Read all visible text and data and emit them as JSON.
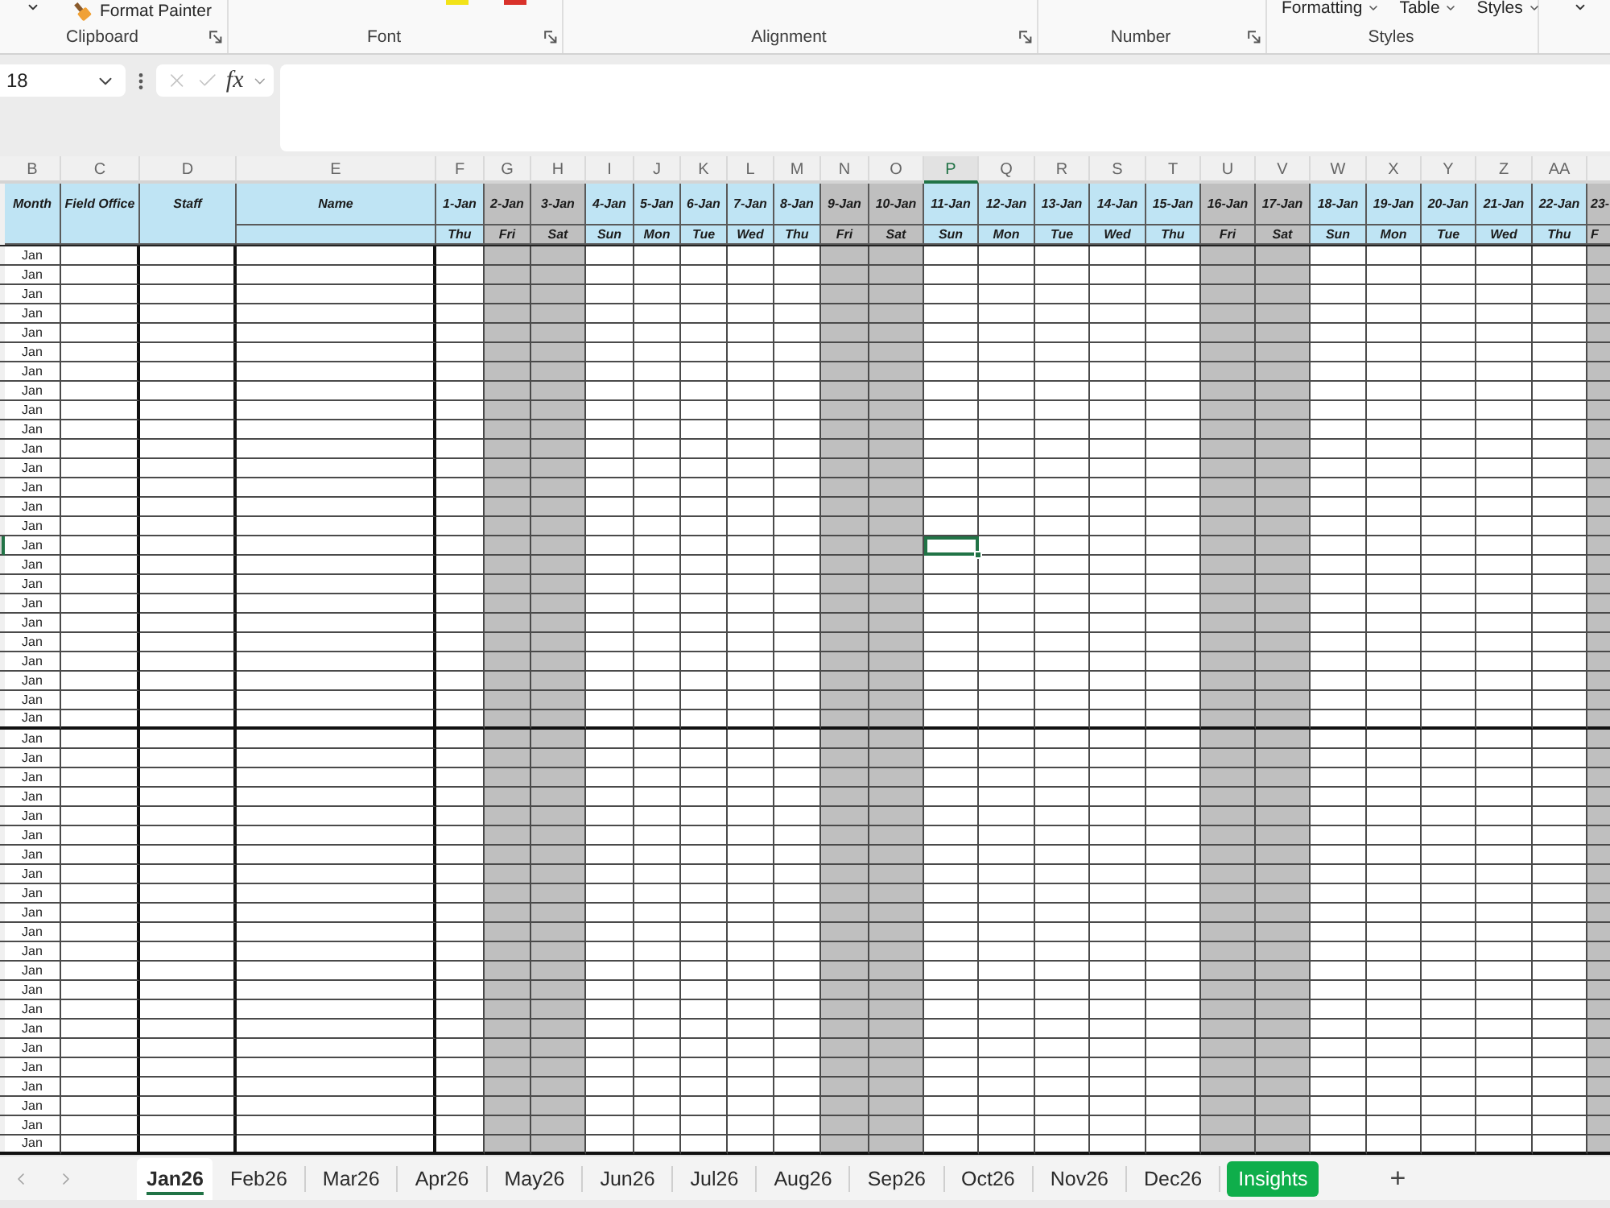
{
  "ribbon": {
    "groups": [
      {
        "label": "Clipboard",
        "launcher": true,
        "items": [
          {
            "kind": "caret"
          },
          {
            "kind": "painter",
            "label": "Format Painter"
          }
        ]
      },
      {
        "label": "Font",
        "launcher": true,
        "items": [
          {
            "kind": "swatch",
            "color": "#f2e318"
          },
          {
            "kind": "swatch",
            "color": "#d9322b"
          }
        ]
      },
      {
        "label": "Alignment",
        "launcher": true
      },
      {
        "label": "Number",
        "launcher": true
      },
      {
        "label": "Styles",
        "items": [
          {
            "kind": "dropdown",
            "label": "Formatting"
          },
          {
            "kind": "dropdown",
            "label": "Table"
          },
          {
            "kind": "dropdown",
            "label": "Styles"
          }
        ]
      },
      {
        "items": [
          {
            "kind": "caret"
          }
        ]
      }
    ]
  },
  "formula_bar": {
    "name_box": "18",
    "function_button": "fx"
  },
  "sheet": {
    "columns": [
      {
        "letter": "B",
        "selected": false
      },
      {
        "letter": "C",
        "selected": false
      },
      {
        "letter": "D",
        "selected": false
      },
      {
        "letter": "E",
        "selected": false
      },
      {
        "letter": "F",
        "selected": false
      },
      {
        "letter": "G",
        "selected": false
      },
      {
        "letter": "H",
        "selected": false
      },
      {
        "letter": "I",
        "selected": false
      },
      {
        "letter": "J",
        "selected": false
      },
      {
        "letter": "K",
        "selected": false
      },
      {
        "letter": "L",
        "selected": false
      },
      {
        "letter": "M",
        "selected": false
      },
      {
        "letter": "N",
        "selected": false
      },
      {
        "letter": "O",
        "selected": false
      },
      {
        "letter": "P",
        "selected": true
      },
      {
        "letter": "Q",
        "selected": false
      },
      {
        "letter": "R",
        "selected": false
      },
      {
        "letter": "S",
        "selected": false
      },
      {
        "letter": "T",
        "selected": false
      },
      {
        "letter": "U",
        "selected": false
      },
      {
        "letter": "V",
        "selected": false
      },
      {
        "letter": "W",
        "selected": false
      },
      {
        "letter": "X",
        "selected": false
      },
      {
        "letter": "Y",
        "selected": false
      },
      {
        "letter": "Z",
        "selected": false
      },
      {
        "letter": "AA",
        "selected": false
      }
    ],
    "fields": [
      "Month",
      "Field Office",
      "Staff",
      "Name"
    ],
    "days": [
      {
        "date": "1-Jan",
        "weekday": "Thu",
        "shaded": false
      },
      {
        "date": "2-Jan",
        "weekday": "Fri",
        "shaded": true
      },
      {
        "date": "3-Jan",
        "weekday": "Sat",
        "shaded": true
      },
      {
        "date": "4-Jan",
        "weekday": "Sun",
        "shaded": false
      },
      {
        "date": "5-Jan",
        "weekday": "Mon",
        "shaded": false
      },
      {
        "date": "6-Jan",
        "weekday": "Tue",
        "shaded": false
      },
      {
        "date": "7-Jan",
        "weekday": "Wed",
        "shaded": false
      },
      {
        "date": "8-Jan",
        "weekday": "Thu",
        "shaded": false
      },
      {
        "date": "9-Jan",
        "weekday": "Fri",
        "shaded": true
      },
      {
        "date": "10-Jan",
        "weekday": "Sat",
        "shaded": true
      },
      {
        "date": "11-Jan",
        "weekday": "Sun",
        "shaded": false
      },
      {
        "date": "12-Jan",
        "weekday": "Mon",
        "shaded": false
      },
      {
        "date": "13-Jan",
        "weekday": "Tue",
        "shaded": false
      },
      {
        "date": "14-Jan",
        "weekday": "Wed",
        "shaded": false
      },
      {
        "date": "15-Jan",
        "weekday": "Thu",
        "shaded": false
      },
      {
        "date": "16-Jan",
        "weekday": "Fri",
        "shaded": true
      },
      {
        "date": "17-Jan",
        "weekday": "Sat",
        "shaded": true
      },
      {
        "date": "18-Jan",
        "weekday": "Sun",
        "shaded": false
      },
      {
        "date": "19-Jan",
        "weekday": "Mon",
        "shaded": false
      },
      {
        "date": "20-Jan",
        "weekday": "Tue",
        "shaded": false
      },
      {
        "date": "21-Jan",
        "weekday": "Wed",
        "shaded": false
      },
      {
        "date": "22-Jan",
        "weekday": "Thu",
        "shaded": false
      },
      {
        "date": "23-",
        "weekday": "F",
        "shaded": true
      }
    ],
    "blocks": [
      {
        "rows": [
          {
            "month": "Jan",
            "selected": false
          },
          {
            "month": "Jan",
            "selected": false
          },
          {
            "month": "Jan",
            "selected": false
          },
          {
            "month": "Jan",
            "selected": false
          },
          {
            "month": "Jan",
            "selected": false
          },
          {
            "month": "Jan",
            "selected": false
          },
          {
            "month": "Jan",
            "selected": false
          },
          {
            "month": "Jan",
            "selected": false
          },
          {
            "month": "Jan",
            "selected": false
          },
          {
            "month": "Jan",
            "selected": false
          },
          {
            "month": "Jan",
            "selected": false
          },
          {
            "month": "Jan",
            "selected": false
          },
          {
            "month": "Jan",
            "selected": false
          },
          {
            "month": "Jan",
            "selected": false
          },
          {
            "month": "Jan",
            "selected": false
          },
          {
            "month": "Jan",
            "selected": true
          },
          {
            "month": "Jan",
            "selected": false
          },
          {
            "month": "Jan",
            "selected": false
          },
          {
            "month": "Jan",
            "selected": false
          },
          {
            "month": "Jan",
            "selected": false
          },
          {
            "month": "Jan",
            "selected": false
          },
          {
            "month": "Jan",
            "selected": false
          },
          {
            "month": "Jan",
            "selected": false
          },
          {
            "month": "Jan",
            "selected": false
          },
          {
            "month": "Jan",
            "selected": false
          }
        ]
      },
      {
        "rows": [
          {
            "month": "Jan",
            "selected": false
          },
          {
            "month": "Jan",
            "selected": false
          },
          {
            "month": "Jan",
            "selected": false
          },
          {
            "month": "Jan",
            "selected": false
          },
          {
            "month": "Jan",
            "selected": false
          },
          {
            "month": "Jan",
            "selected": false
          },
          {
            "month": "Jan",
            "selected": false
          },
          {
            "month": "Jan",
            "selected": false
          },
          {
            "month": "Jan",
            "selected": false
          },
          {
            "month": "Jan",
            "selected": false
          },
          {
            "month": "Jan",
            "selected": false
          },
          {
            "month": "Jan",
            "selected": false
          },
          {
            "month": "Jan",
            "selected": false
          },
          {
            "month": "Jan",
            "selected": false
          },
          {
            "month": "Jan",
            "selected": false
          },
          {
            "month": "Jan",
            "selected": false
          },
          {
            "month": "Jan",
            "selected": false
          },
          {
            "month": "Jan",
            "selected": false
          },
          {
            "month": "Jan",
            "selected": false
          },
          {
            "month": "Jan",
            "selected": false
          },
          {
            "month": "Jan",
            "selected": false
          },
          {
            "month": "Jan",
            "selected": false
          }
        ]
      }
    ]
  },
  "sheet_tabs": {
    "tabs": [
      {
        "label": "Jan26",
        "selected": true
      },
      {
        "label": "Feb26",
        "selected": false
      },
      {
        "label": "Mar26",
        "selected": false
      },
      {
        "label": "Apr26",
        "selected": false
      },
      {
        "label": "May26",
        "selected": false
      },
      {
        "label": "Jun26",
        "selected": false
      },
      {
        "label": "Jul26",
        "selected": false
      },
      {
        "label": "Aug26",
        "selected": false
      },
      {
        "label": "Sep26",
        "selected": false
      },
      {
        "label": "Oct26",
        "selected": false
      },
      {
        "label": "Nov26",
        "selected": false
      },
      {
        "label": "Dec26",
        "selected": false
      },
      {
        "label": "Insights",
        "selected": false,
        "color": "#0fae4b"
      }
    ],
    "add_button": "+"
  }
}
